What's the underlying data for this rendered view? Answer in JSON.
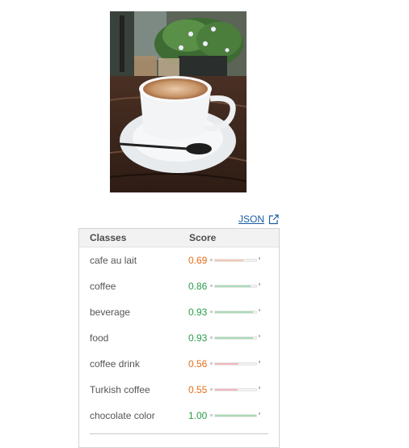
{
  "json_link": {
    "label": "JSON",
    "icon": "external-link-icon"
  },
  "table": {
    "headers": {
      "classes": "Classes",
      "score": "Score"
    },
    "rows": [
      {
        "class": "cafe au lait",
        "score": "0.69",
        "value": 0.69,
        "color": "#e46e1b",
        "bar": "#f4c8b4"
      },
      {
        "class": "coffee",
        "score": "0.86",
        "value": 0.86,
        "color": "#2a9d4b",
        "bar": "#a9dcb7"
      },
      {
        "class": "beverage",
        "score": "0.93",
        "value": 0.93,
        "color": "#2a9d4b",
        "bar": "#a9dcb7"
      },
      {
        "class": "food",
        "score": "0.93",
        "value": 0.93,
        "color": "#2a9d4b",
        "bar": "#a9dcb7"
      },
      {
        "class": "coffee drink",
        "score": "0.56",
        "value": 0.56,
        "color": "#e46e1b",
        "bar": "#f3b7bd"
      },
      {
        "class": "Turkish coffee",
        "score": "0.55",
        "value": 0.55,
        "color": "#e46e1b",
        "bar": "#f3b7bd"
      },
      {
        "class": "chocolate color",
        "score": "1.00",
        "value": 1.0,
        "color": "#2a9d4b",
        "bar": "#a9dcb7"
      }
    ]
  }
}
